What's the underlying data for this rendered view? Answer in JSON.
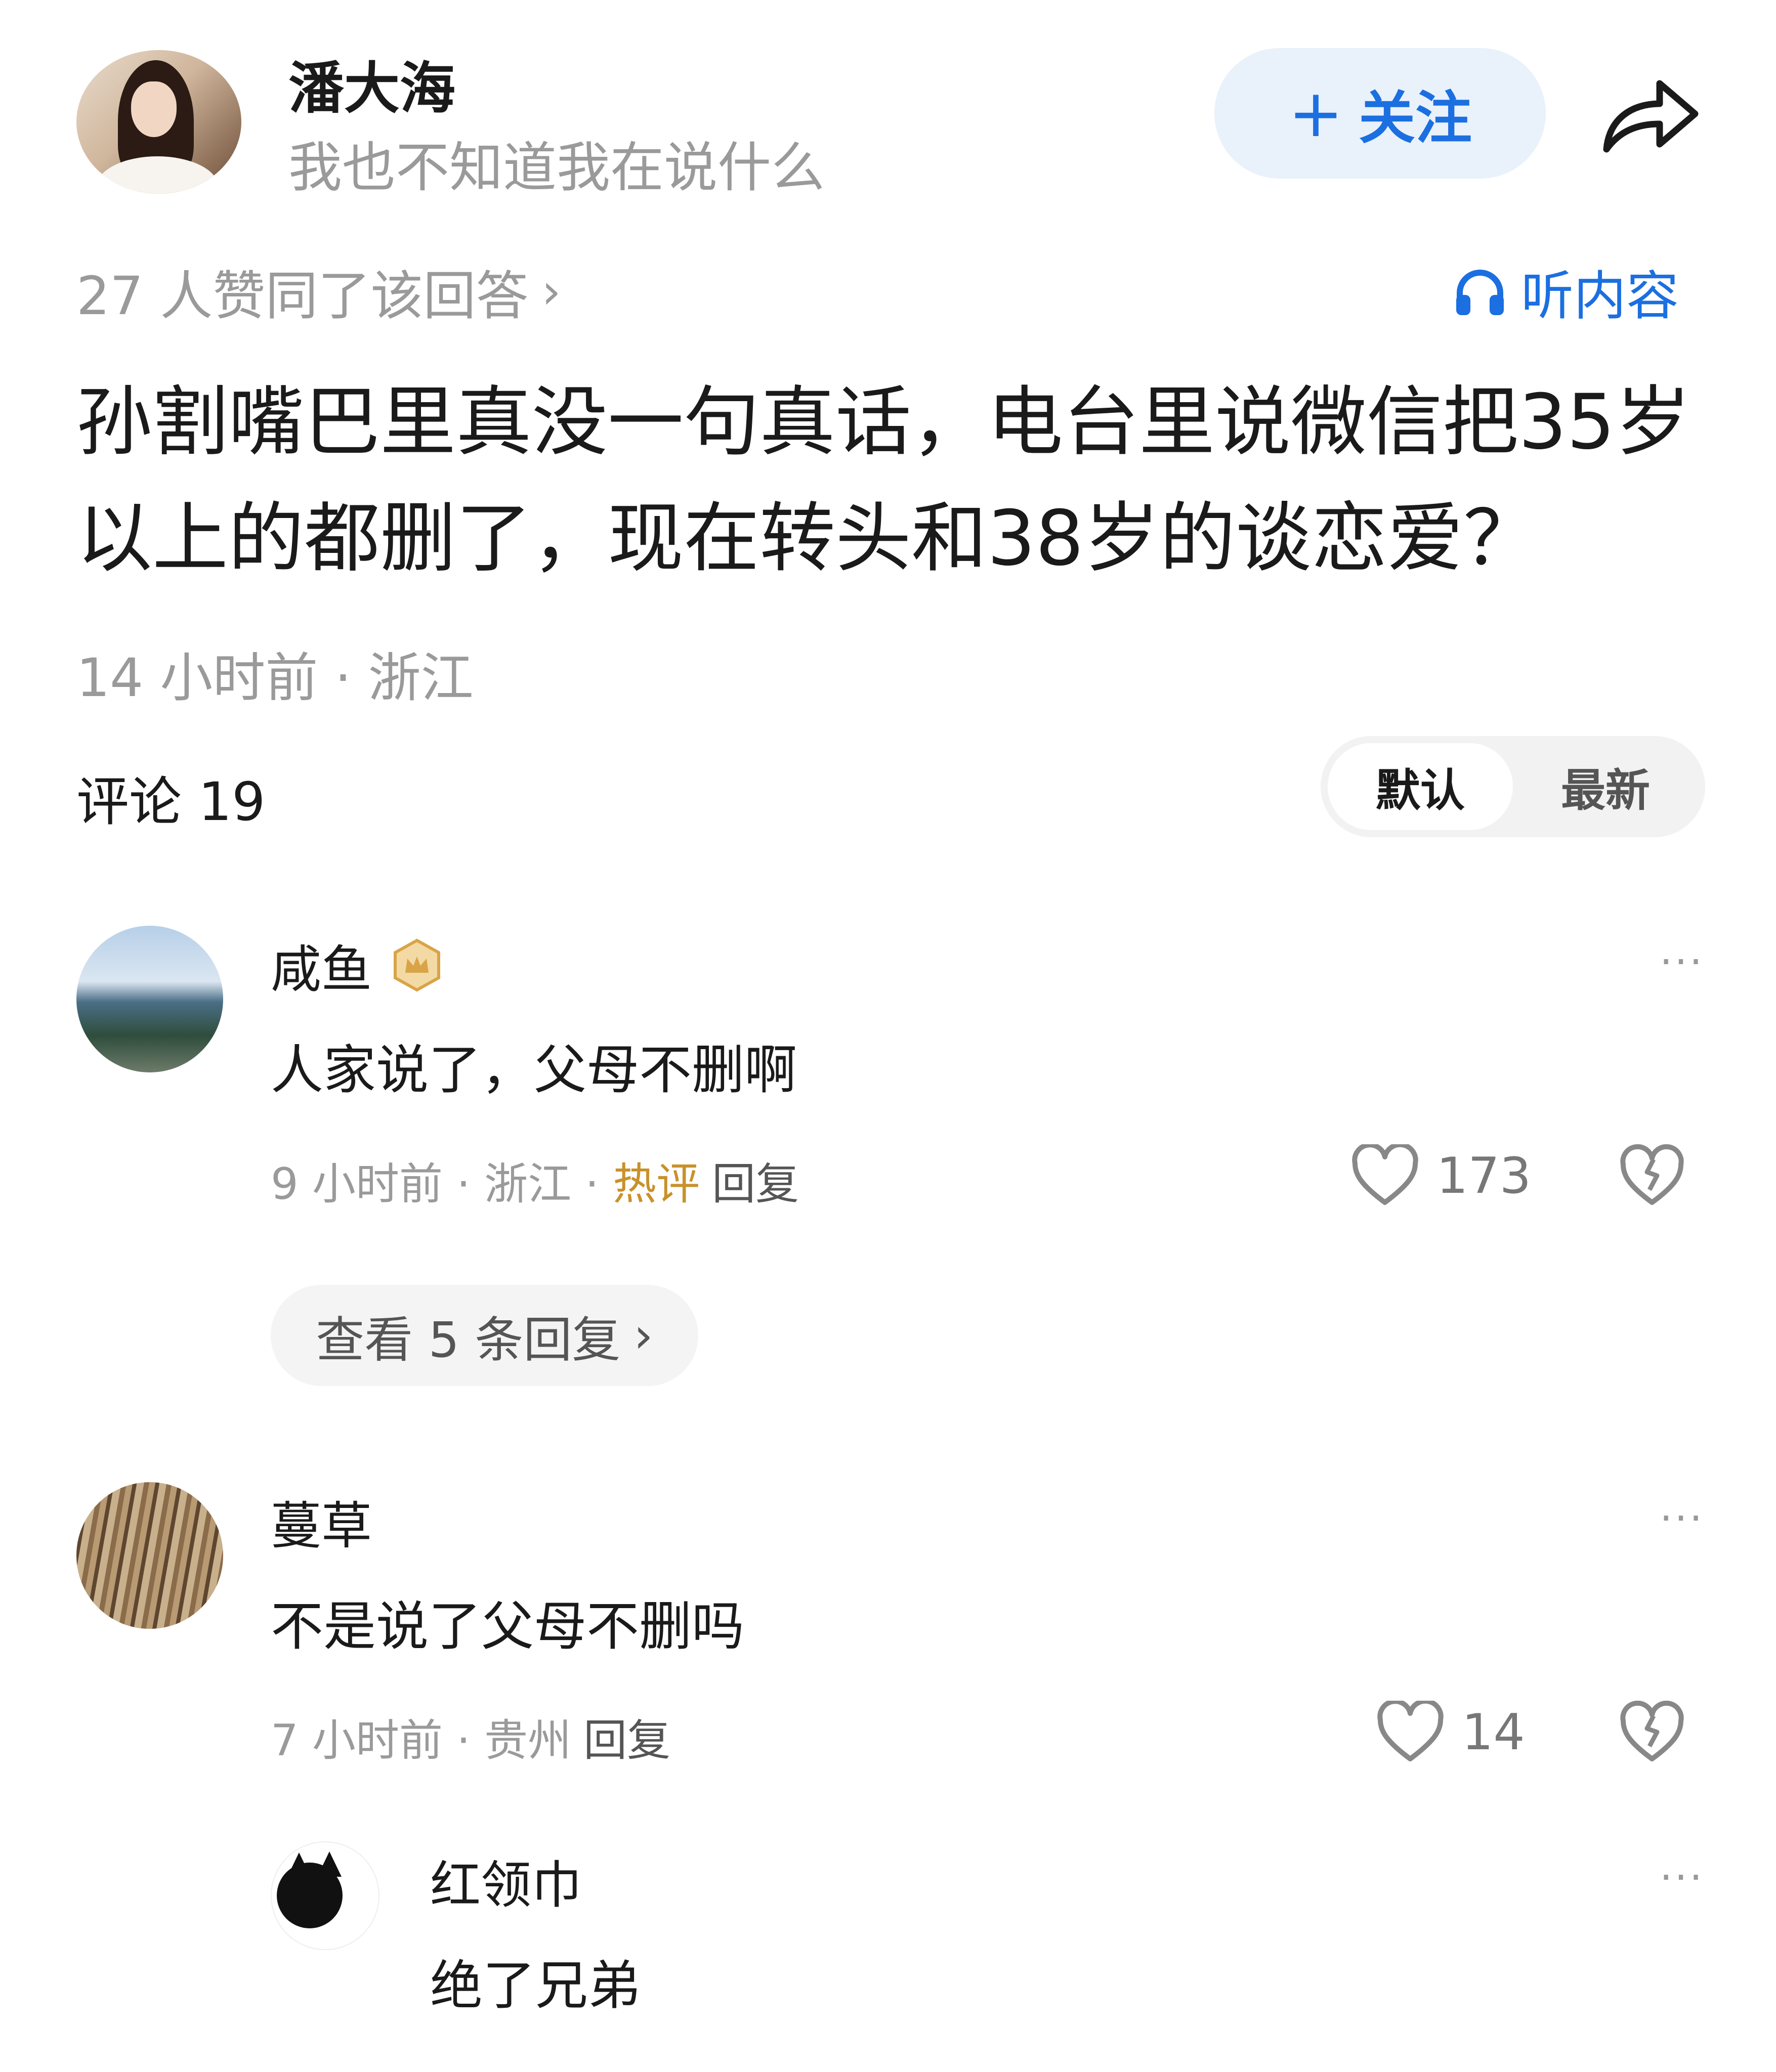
{
  "author": {
    "name": "潘大海",
    "bio": "我也不知道我在说什么",
    "follow_label": "关注",
    "follow_plus": "+"
  },
  "answer": {
    "agree_text": "27 人赞同了该回答",
    "agree_chevron": "›",
    "listen_label": "听内容",
    "text": "孙割嘴巴里真没一句真话，电台里说微信把35岁以上的都删了，现在转头和38岁的谈恋爱？",
    "meta": "14 小时前 · 浙江"
  },
  "comments_header": {
    "title": "评论 19",
    "sort_default": "默认",
    "sort_latest": "最新"
  },
  "comments": [
    {
      "name": "咸鱼",
      "text": "人家说了，父母不删啊",
      "meta_prefix": "9 小时前 · 浙江 · ",
      "hot_label": "热评",
      "reply_label": "回复",
      "likes": "173",
      "view_replies": "查看 5 条回复",
      "view_chevron": "›"
    },
    {
      "name": "蔓草",
      "text": "不是说了父母不删吗",
      "meta_prefix": "7 小时前 · 贵州",
      "reply_label": "回复",
      "likes": "14"
    },
    {
      "name": "红领巾",
      "text": "绝了兄弟"
    }
  ],
  "more_glyph": "···",
  "colors": {
    "accent_blue": "#1b6fe0",
    "hot_gold": "#c9912a",
    "muted_gray": "#9a9a9a"
  },
  "icons": [
    "share-icon",
    "headphones-icon",
    "chevron-right-icon",
    "more-icon",
    "heart-icon",
    "broken-heart-icon",
    "crown-badge-icon"
  ]
}
